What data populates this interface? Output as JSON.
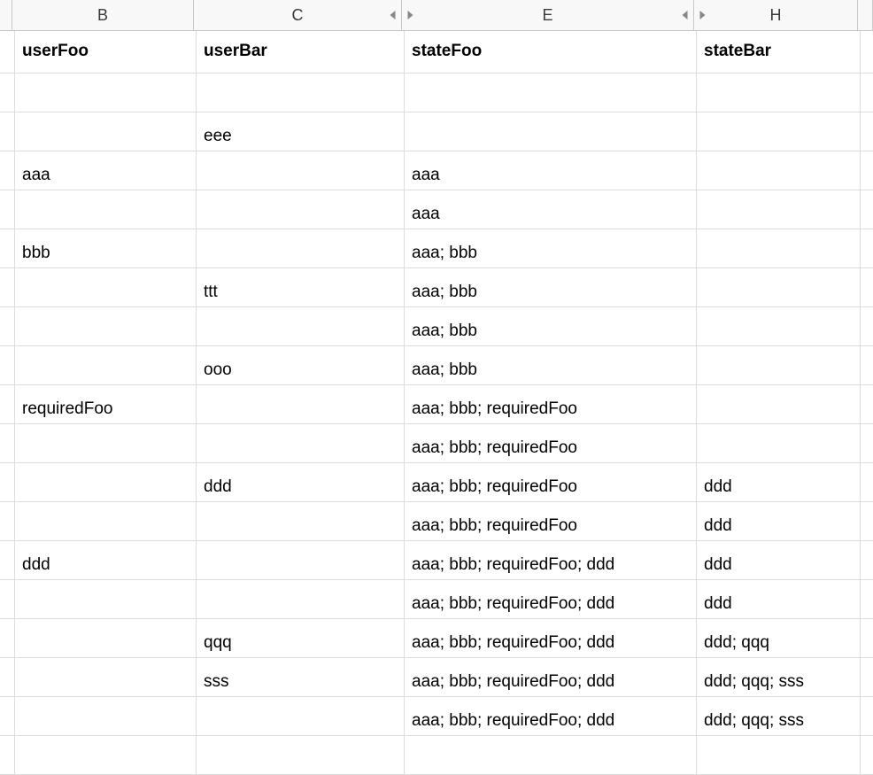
{
  "columns": {
    "B": "B",
    "C": "C",
    "E": "E",
    "H": "H"
  },
  "headers": {
    "B": "userFoo",
    "C": "userBar",
    "E": "stateFoo",
    "H": "stateBar"
  },
  "rows": [
    {
      "B": "",
      "C": "",
      "E": "",
      "H": ""
    },
    {
      "B": "",
      "C": "eee",
      "E": "",
      "H": ""
    },
    {
      "B": "aaa",
      "C": "",
      "E": "aaa",
      "H": ""
    },
    {
      "B": "",
      "C": "",
      "E": "aaa",
      "H": ""
    },
    {
      "B": "bbb",
      "C": "",
      "E": "aaa; bbb",
      "H": ""
    },
    {
      "B": "",
      "C": "ttt",
      "E": "aaa; bbb",
      "H": ""
    },
    {
      "B": "",
      "C": "",
      "E": "aaa; bbb",
      "H": ""
    },
    {
      "B": "",
      "C": "ooo",
      "E": "aaa; bbb",
      "H": ""
    },
    {
      "B": "requiredFoo",
      "C": "",
      "E": "aaa; bbb; requiredFoo",
      "H": ""
    },
    {
      "B": "",
      "C": "",
      "E": "aaa; bbb; requiredFoo",
      "H": ""
    },
    {
      "B": "",
      "C": "ddd",
      "E": "aaa; bbb; requiredFoo",
      "H": "ddd"
    },
    {
      "B": "",
      "C": "",
      "E": "aaa; bbb; requiredFoo",
      "H": "ddd"
    },
    {
      "B": "ddd",
      "C": "",
      "E": "aaa; bbb; requiredFoo; ddd",
      "H": "ddd"
    },
    {
      "B": "",
      "C": "",
      "E": "aaa; bbb; requiredFoo; ddd",
      "H": "ddd"
    },
    {
      "B": "",
      "C": "qqq",
      "E": "aaa; bbb; requiredFoo; ddd",
      "H": "ddd; qqq"
    },
    {
      "B": "",
      "C": "sss",
      "E": "aaa; bbb; requiredFoo; ddd",
      "H": "ddd; qqq; sss"
    },
    {
      "B": "",
      "C": "",
      "E": "aaa; bbb; requiredFoo; ddd",
      "H": "ddd; qqq; sss"
    },
    {
      "B": "",
      "C": "",
      "E": "",
      "H": ""
    }
  ]
}
